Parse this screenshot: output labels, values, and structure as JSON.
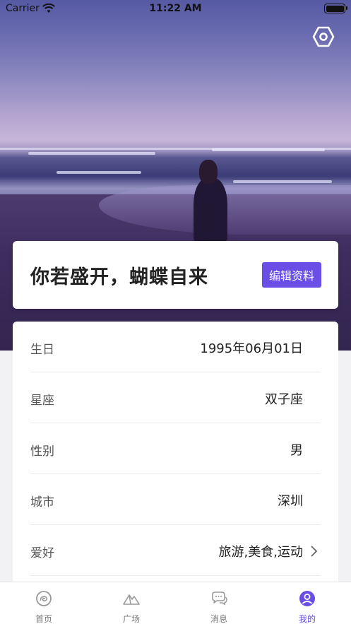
{
  "status_bar": {
    "carrier": "Carrier",
    "time": "11:22 AM"
  },
  "profile": {
    "slogan": "你若盛开，蝴蝶自来",
    "edit_label": "编辑资料"
  },
  "info": [
    {
      "label": "生日",
      "value": "1995年06月01日",
      "has_arrow": false
    },
    {
      "label": "星座",
      "value": "双子座",
      "has_arrow": false
    },
    {
      "label": "性别",
      "value": "男",
      "has_arrow": false
    },
    {
      "label": "城市",
      "value": "深圳",
      "has_arrow": false
    },
    {
      "label": "爱好",
      "value": "旅游,美食,运动",
      "has_arrow": true
    }
  ],
  "tabs": [
    {
      "label": "首页",
      "icon": "home-swirl-icon",
      "active": false
    },
    {
      "label": "广场",
      "icon": "mountain-icon",
      "active": false
    },
    {
      "label": "消息",
      "icon": "chat-bubbles-icon",
      "active": false
    },
    {
      "label": "我的",
      "icon": "user-icon",
      "active": true
    }
  ],
  "colors": {
    "accent": "#6a4ee6",
    "inactive": "#777777"
  }
}
